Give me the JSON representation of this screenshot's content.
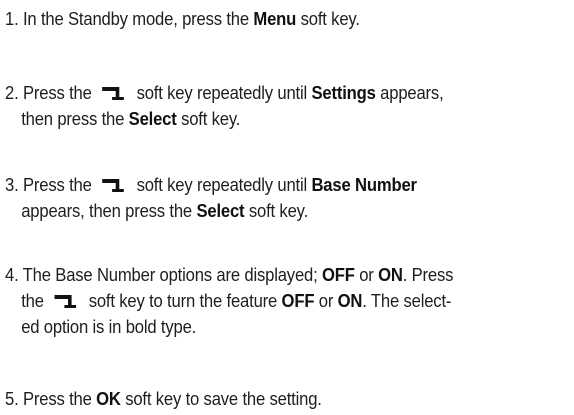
{
  "steps": [
    {
      "lines": [
        [
          {
            "t": "1. In the Standby mode, press the "
          },
          {
            "t": "Menu",
            "b": true
          },
          {
            "t": " soft key."
          }
        ]
      ]
    },
    {
      "lines": [
        [
          {
            "t": "2. Press the "
          },
          {
            "icon": "down-arrow-soft-key-icon"
          },
          {
            "t": " soft key repeatedly until "
          },
          {
            "t": "Settings",
            "b": true
          },
          {
            "t": " appears,"
          }
        ],
        [
          {
            "t": "then press the "
          },
          {
            "t": "Select",
            "b": true
          },
          {
            "t": " soft key."
          }
        ]
      ]
    },
    {
      "lines": [
        [
          {
            "t": "3. Press the "
          },
          {
            "icon": "down-arrow-soft-key-icon"
          },
          {
            "t": " soft key repeatedly until "
          },
          {
            "t": "Base Number",
            "b": true
          }
        ],
        [
          {
            "t": "appears, then press the "
          },
          {
            "t": "Select",
            "b": true
          },
          {
            "t": " soft key."
          }
        ]
      ]
    },
    {
      "lines": [
        [
          {
            "t": "4. The Base Number options are displayed; "
          },
          {
            "t": "OFF",
            "b": true
          },
          {
            "t": " or "
          },
          {
            "t": "ON",
            "b": true
          },
          {
            "t": ". Press"
          }
        ],
        [
          {
            "t": "the "
          },
          {
            "icon": "down-arrow-soft-key-icon"
          },
          {
            "t": " soft key to turn the feature "
          },
          {
            "t": "OFF",
            "b": true
          },
          {
            "t": " or "
          },
          {
            "t": "ON",
            "b": true
          },
          {
            "t": ". The select-"
          }
        ],
        [
          {
            "t": "ed option is in bold type."
          }
        ]
      ]
    },
    {
      "lines": [
        [
          {
            "t": "5. Press the "
          },
          {
            "t": "OK",
            "b": true
          },
          {
            "t": " soft key to save the setting."
          }
        ]
      ]
    }
  ]
}
